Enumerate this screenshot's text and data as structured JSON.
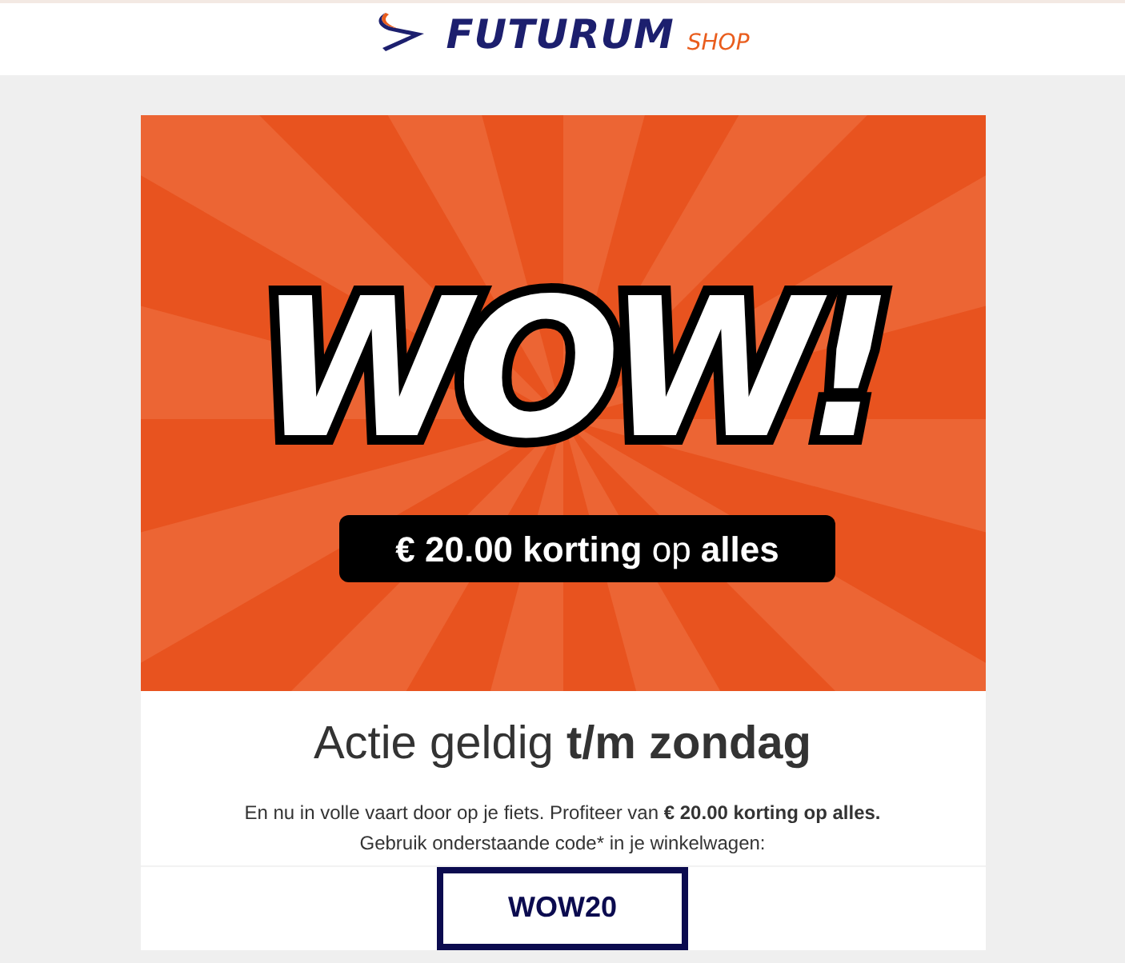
{
  "header": {
    "logo": {
      "brand": "FUTURUM",
      "suffix": "SHOP"
    }
  },
  "banner": {
    "headline": "WOW!",
    "subline": "**€ 20.00 korting** op **alles**"
  },
  "title": "Actie geldig **t/m zondag**",
  "paragraphs": [
    "En nu in volle vaart door op je fiets. Profiteer van **€ 20.00 korting op alles.**",
    "Gebruik onderstaande code* in je winkelwagen:"
  ],
  "code": "WOW20"
}
